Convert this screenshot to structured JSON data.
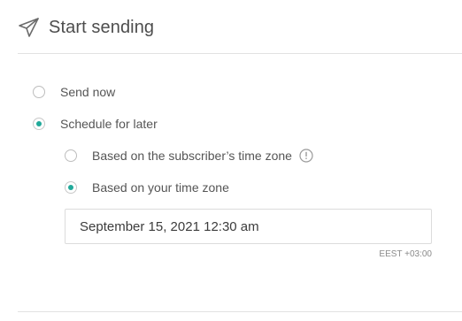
{
  "header": {
    "title": "Start sending",
    "icon": "paper-plane-icon"
  },
  "options": {
    "send_now": {
      "label": "Send now",
      "checked": false
    },
    "schedule_later": {
      "label": "Schedule for later",
      "checked": true
    }
  },
  "schedule": {
    "subscriber_tz": {
      "label": "Based on the subscriber’s time zone",
      "checked": false,
      "icon": "info-icon"
    },
    "your_tz": {
      "label": "Based on your time zone",
      "checked": true
    },
    "datetime_value": "September 15, 2021 12:30 am",
    "timezone_label": "EEST +03:00"
  },
  "colors": {
    "accent": "#21a99a",
    "border": "#dcdcdc",
    "text": "#555555"
  }
}
